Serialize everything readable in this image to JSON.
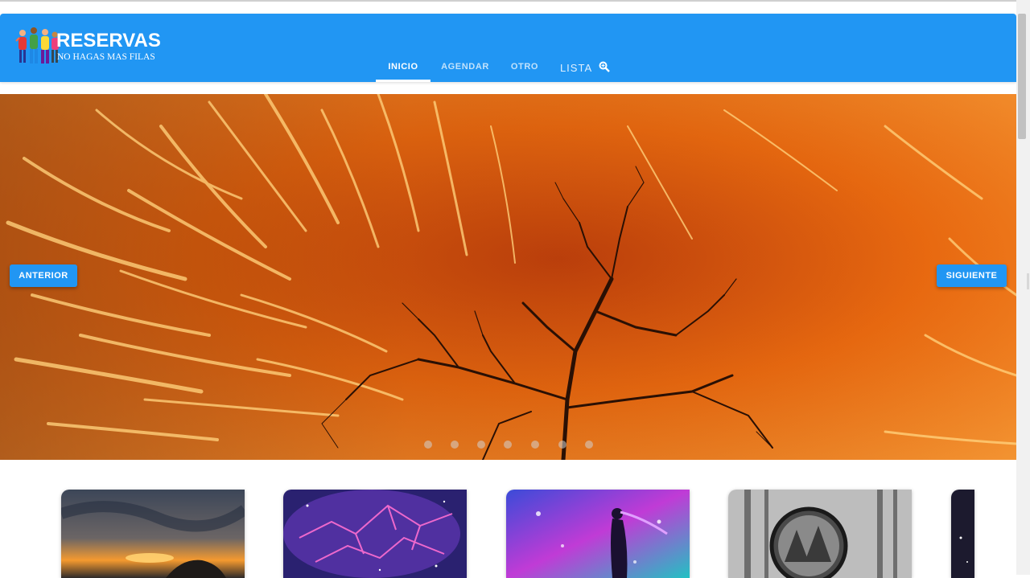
{
  "brand": {
    "title": "RESERVAS",
    "subtitle": "NO HAGAS MAS FILAS"
  },
  "nav": {
    "tabs": [
      {
        "label": "INICIO",
        "active": true
      },
      {
        "label": "AGENDAR",
        "active": false
      },
      {
        "label": "OTRO",
        "active": false
      }
    ],
    "list_label": "LISTA",
    "list_icon": "search-icon"
  },
  "carousel": {
    "prev_label": "ANTERIOR",
    "next_label": "SIGUIENTE",
    "slide_count": 7,
    "active_slide": 1
  },
  "colors": {
    "primary": "#2196f3",
    "hero_orange": "#e8650f"
  },
  "cards": [
    {
      "image": "sunset-clouds"
    },
    {
      "image": "purple-nebula"
    },
    {
      "image": "girl-galaxy"
    },
    {
      "image": "bw-forest-lens"
    },
    {
      "image": "space-partial"
    }
  ]
}
